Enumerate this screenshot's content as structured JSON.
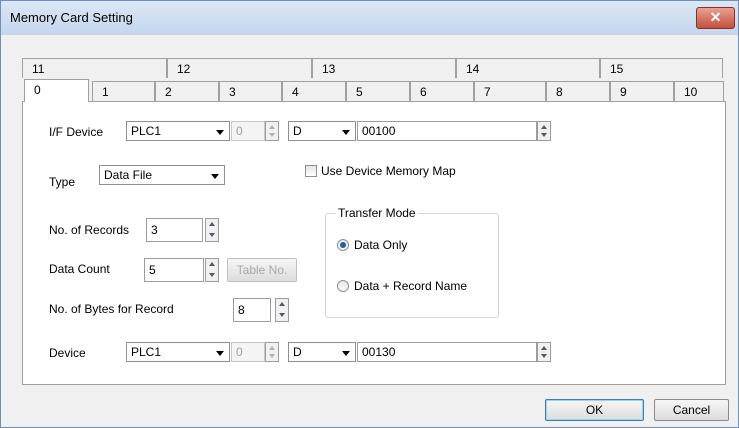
{
  "window": {
    "title": "Memory Card Setting",
    "close_glyph": "✕"
  },
  "tabs_top": [
    "11",
    "12",
    "13",
    "14",
    "15"
  ],
  "tabs_bottom": [
    "0",
    "1",
    "2",
    "3",
    "4",
    "5",
    "6",
    "7",
    "8",
    "9",
    "10"
  ],
  "active_tab": "0",
  "if_device": {
    "label": "I/F Device",
    "plc": "PLC1",
    "station": "0",
    "device": "D",
    "address": "00100"
  },
  "type": {
    "label": "Type",
    "value": "Data File"
  },
  "use_map": {
    "label": "Use Device Memory Map",
    "checked": false
  },
  "records": {
    "label": "No. of Records",
    "value": "3"
  },
  "data_count": {
    "label": "Data Count",
    "value": "5",
    "table_button": "Table No."
  },
  "bytes": {
    "label": "No. of Bytes for Record",
    "value": "8"
  },
  "transfer": {
    "title": "Transfer Mode",
    "opt1": "Data Only",
    "opt2": "Data + Record Name",
    "selected": "Data Only"
  },
  "device": {
    "label": "Device",
    "plc": "PLC1",
    "station": "0",
    "device": "D",
    "address": "00130"
  },
  "buttons": {
    "ok": "OK",
    "cancel": "Cancel"
  },
  "colors": {
    "title_bar": "#c4d5ec",
    "close_button": "#c4503c",
    "radio_dot": "#1f5ea8"
  }
}
